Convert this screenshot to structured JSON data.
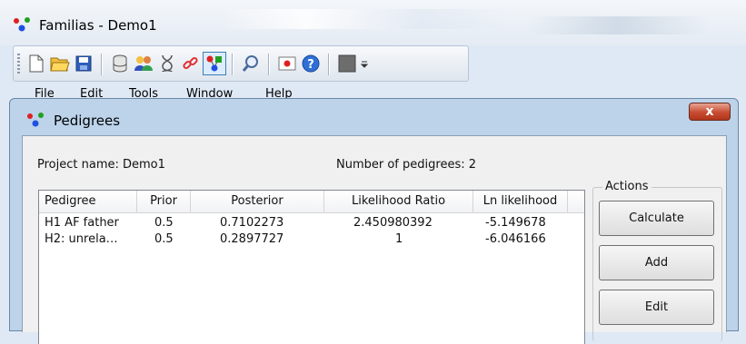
{
  "app": {
    "title": "Familias - Demo1",
    "menu": [
      "File",
      "Edit",
      "Tools",
      "Window",
      "Help"
    ]
  },
  "toolbar": {
    "icons": [
      "new-file-icon",
      "open-folder-icon",
      "save-icon",
      "database-icon",
      "persons-icon",
      "dna-icon",
      "link-icon",
      "pedigree-icon",
      "search-icon",
      "record-icon",
      "help-icon",
      "color-icon"
    ]
  },
  "dialog": {
    "title": "Pedigrees",
    "close_label": "x",
    "project_label": "Project name: Demo1",
    "count_label": "Number of pedigrees: 2",
    "actions_legend": "Actions",
    "actions": [
      "Calculate",
      "Add",
      "Edit"
    ]
  },
  "table": {
    "columns": [
      "Pedigree",
      "Prior",
      "Posterior",
      "Likelihood Ratio",
      "Ln likelihood"
    ],
    "rows": [
      [
        "H1 AF father",
        "0.5",
        "0.7102273",
        "2.450980392",
        "-5.149678"
      ],
      [
        "H2: unrela…",
        "0.5",
        "0.2897727",
        "1",
        "-6.046166"
      ]
    ]
  },
  "colors": {
    "accent_red": "#e02020",
    "accent_green": "#20a020",
    "accent_blue": "#2050e0",
    "close_red": "#c74c31"
  }
}
